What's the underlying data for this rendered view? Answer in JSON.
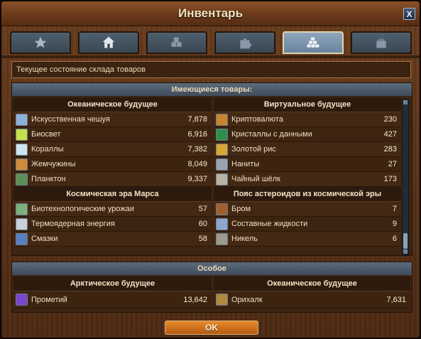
{
  "window": {
    "title": "Инвентарь",
    "close_label": "X"
  },
  "tabs": [
    {
      "icon": "star-icon",
      "active": false
    },
    {
      "icon": "house-icon",
      "active": false
    },
    {
      "icon": "crates-icon",
      "active": false
    },
    {
      "icon": "puzzle-icon",
      "active": false
    },
    {
      "icon": "stacked-goods-icon",
      "active": true
    },
    {
      "icon": "castle-icon",
      "active": false
    }
  ],
  "status": "Текущее состояние склада товаров",
  "available": {
    "header": "Имеющиеся товары:",
    "left_groups": [
      {
        "title": "Океаническое будущее",
        "items": [
          {
            "name": "Искусственная чешуя",
            "value": "7,878",
            "color": "#8fb0d8"
          },
          {
            "name": "Биосвет",
            "value": "6,916",
            "color": "#c7e04a"
          },
          {
            "name": "Кораллы",
            "value": "7,382",
            "color": "#cfe6ef"
          },
          {
            "name": "Жемчужины",
            "value": "8,049",
            "color": "#d08a3a"
          },
          {
            "name": "Планктон",
            "value": "9,337",
            "color": "#5d8f57"
          }
        ]
      },
      {
        "title": "Космическая эра Марса",
        "items": [
          {
            "name": "Биотехнологические урожаи",
            "value": "57",
            "color": "#7fb07a"
          },
          {
            "name": "Термоядерная энергия",
            "value": "60",
            "color": "#c8cfd8"
          },
          {
            "name": "Смазки",
            "value": "58",
            "color": "#5a7fc0"
          }
        ]
      }
    ],
    "right_groups": [
      {
        "title": "Виртуальное будущее",
        "items": [
          {
            "name": "Криптовалюта",
            "value": "230",
            "color": "#c9852c"
          },
          {
            "name": "Кристаллы с данными",
            "value": "427",
            "color": "#2f8f4a"
          },
          {
            "name": "Золотой рис",
            "value": "283",
            "color": "#d9a630"
          },
          {
            "name": "Наниты",
            "value": "27",
            "color": "#9aa3ad"
          },
          {
            "name": "Чайный шёлк",
            "value": "173",
            "color": "#b9b2a4"
          }
        ]
      },
      {
        "title": "Пояс астероидов из космической эры",
        "items": [
          {
            "name": "Бром",
            "value": "7",
            "color": "#a3602d"
          },
          {
            "name": "Составные жидкости",
            "value": "9",
            "color": "#8fa6cf"
          },
          {
            "name": "Никель",
            "value": "6",
            "color": "#9b9a8d"
          }
        ]
      }
    ]
  },
  "special": {
    "header": "Особое",
    "left": {
      "title": "Арктическое будущее",
      "item": {
        "name": "Прометий",
        "value": "13,642",
        "color": "#7a45c8"
      }
    },
    "right": {
      "title": "Океаническое будущее",
      "item": {
        "name": "Орихалк",
        "value": "7,631",
        "color": "#b08a3a"
      }
    }
  },
  "ok_label": "OK"
}
